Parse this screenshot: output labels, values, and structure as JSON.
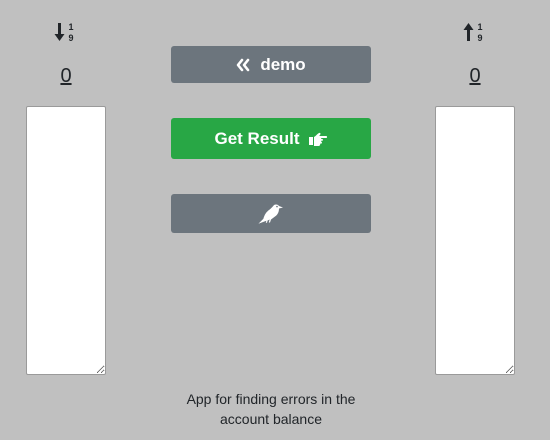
{
  "left_panel": {
    "sort_icon": "sort-numeric-down-icon",
    "count": "0",
    "list_value": ""
  },
  "right_panel": {
    "sort_icon": "sort-numeric-up-icon",
    "count": "0",
    "list_value": ""
  },
  "buttons": {
    "demo": {
      "label": "demo",
      "icon": "angle-double-left-icon"
    },
    "get_result": {
      "label": "Get Result",
      "icon": "hand-point-right-icon"
    },
    "crow": {
      "icon": "crow-icon"
    }
  },
  "footer": {
    "text": "App for finding errors in the account balance"
  },
  "colors": {
    "background": "#c0c0c0",
    "secondary_button": "#6c757d",
    "success_button": "#28a745"
  }
}
